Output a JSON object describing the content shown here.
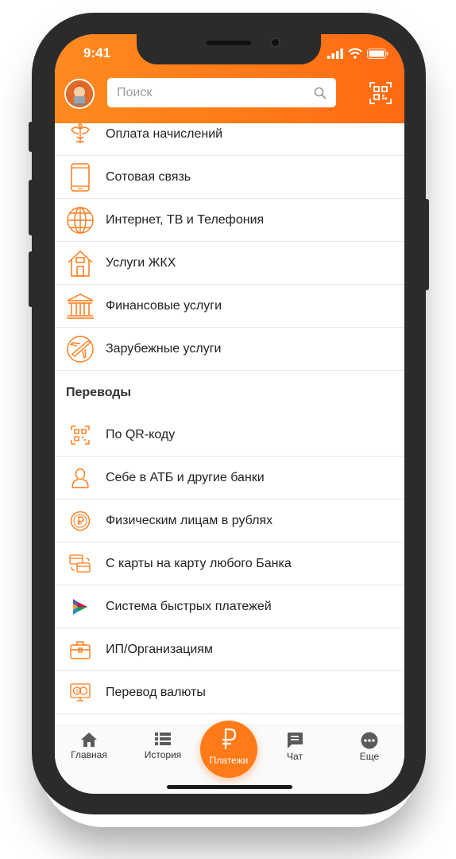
{
  "status_bar": {
    "time": "9:41"
  },
  "header": {
    "search": {
      "placeholder": "Поиск"
    }
  },
  "payments": [
    {
      "label": "Оплата начислений",
      "icon": "emblem-icon"
    },
    {
      "label": "Сотовая связь",
      "icon": "phone-icon"
    },
    {
      "label": "Интернет, ТВ и Телефония",
      "icon": "globe-icon"
    },
    {
      "label": "Услуги ЖКХ",
      "icon": "house-icon"
    },
    {
      "label": "Финансовые услуги",
      "icon": "bank-icon"
    },
    {
      "label": "Зарубежные услуги",
      "icon": "plane-icon"
    }
  ],
  "transfers": {
    "title": "Переводы",
    "items": [
      {
        "label": "По QR-коду",
        "icon": "qr-code-icon"
      },
      {
        "label": "Себе в АТБ и другие банки",
        "icon": "person-icon"
      },
      {
        "label": "Физическим лицам в рублях",
        "icon": "ruble-coin-icon"
      },
      {
        "label": "С карты на карту любого Банка",
        "icon": "cards-icon"
      },
      {
        "label": "Система быстрых платежей",
        "icon": "sbp-logo-icon"
      },
      {
        "label": "ИП/Организациям",
        "icon": "briefcase-icon"
      },
      {
        "label": "Перевод валюты",
        "icon": "currency-monitor-icon"
      }
    ]
  },
  "tabbar": {
    "home": "Главная",
    "history": "История",
    "payments": "Платежи",
    "chat": "Чат",
    "more": "Еще"
  },
  "colors": {
    "accent": "#ff7a18",
    "text": "#222222",
    "divider": "#e6e6e6"
  }
}
